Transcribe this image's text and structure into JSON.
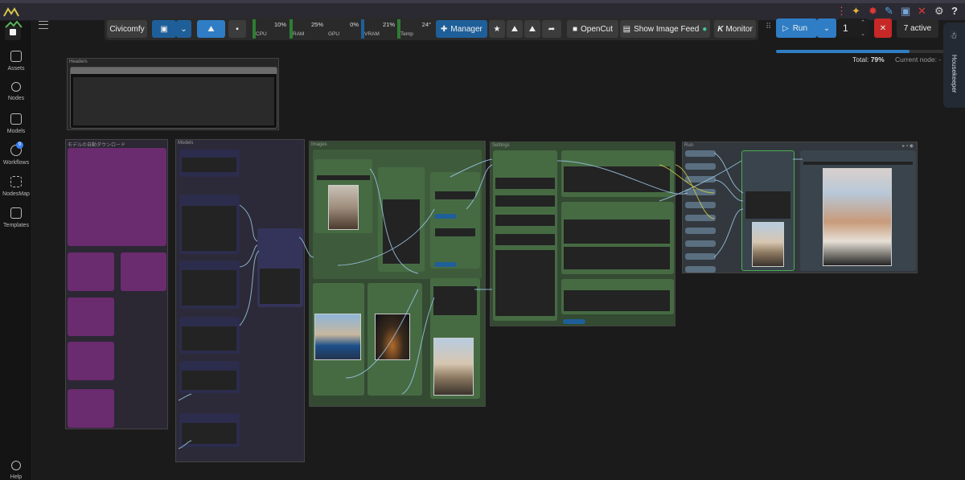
{
  "toolbar": {
    "workspace": "Civicomfy",
    "manager_label": "Manager",
    "opencut_label": "OpenCut",
    "image_feed_label": "Show Image Feed",
    "monitor_label": "Monitor",
    "run_label": "Run",
    "queue_count": "1",
    "active_label": "7 active"
  },
  "monitors": [
    {
      "label": "CPU",
      "value": "10%",
      "color": "#2e7d32"
    },
    {
      "label": "RAM",
      "value": "25%",
      "color": "#2e7d32"
    },
    {
      "label": "GPU",
      "value": "0%",
      "color": "#2e7d32"
    },
    {
      "label": "VRAM",
      "value": "21%",
      "color": "#1f5f99"
    },
    {
      "label": "Temp",
      "value": "24°",
      "color": "#2e7d32"
    }
  ],
  "progress": {
    "total_label": "Total:",
    "total_value": "79%",
    "current_label": "Current node:",
    "current_value": "-",
    "fraction": 0.79
  },
  "housekeeper": "Housekeeper",
  "sidebar": {
    "items": [
      {
        "label": "Assets",
        "icon": "image-icon"
      },
      {
        "label": "Nodes",
        "icon": "nodes-icon"
      },
      {
        "label": "Models",
        "icon": "models-icon"
      },
      {
        "label": "Workflows",
        "icon": "workflow-icon",
        "badge": "9"
      },
      {
        "label": "NodesMap",
        "icon": "map-icon"
      },
      {
        "label": "Templates",
        "icon": "templates-icon"
      }
    ],
    "help_label": "Help"
  },
  "groups": {
    "headers": "Headers",
    "download": "モデルの自動ダウンロード",
    "models": "Models",
    "images": "Images",
    "settings": "Settings",
    "run": "Run"
  },
  "colors": {
    "purple_group": "#2b2733",
    "green_group": "#344a32",
    "run_group": "#32383d",
    "purple_node": "#6b2b6f",
    "node_navy": "#2c2c4c"
  }
}
